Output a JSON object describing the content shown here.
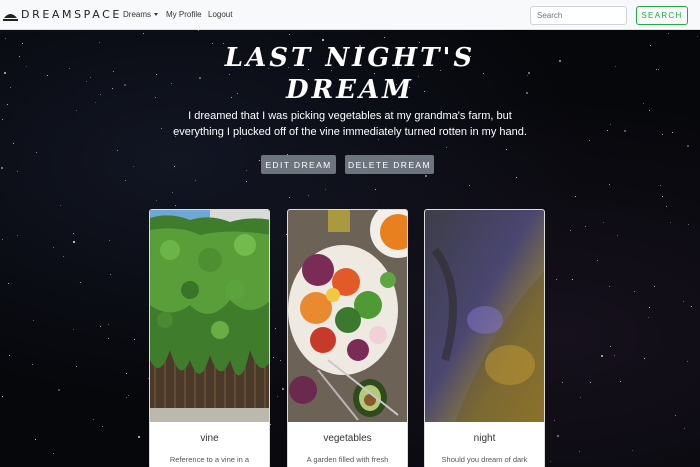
{
  "nav": {
    "brand": "DREAMSPACE",
    "links": [
      "Dreams",
      "My Profile",
      "Logout"
    ],
    "search_placeholder": "Search",
    "search_button": "SEARCH"
  },
  "hero": {
    "title_line1": "LAST NIGHT'S",
    "title_line2": "DREAM",
    "description": "I dreamed that I was picking vegetables at my grandma's farm, but everything I plucked off of the vine immediately turned rotten in my hand.",
    "edit_button": "EDIT DREAM",
    "delete_button": "DELETE DREAM"
  },
  "cards": [
    {
      "title": "vine",
      "text": "Reference to a vine in a"
    },
    {
      "title": "vegetables",
      "text": "A garden filled with fresh"
    },
    {
      "title": "night",
      "text": "Should you dream of dark"
    }
  ],
  "colors": {
    "navbar_bg": "#f8f9fa",
    "search_accent": "#28a745",
    "button_bg": "#6c757d",
    "space_bg": "#06070b"
  }
}
